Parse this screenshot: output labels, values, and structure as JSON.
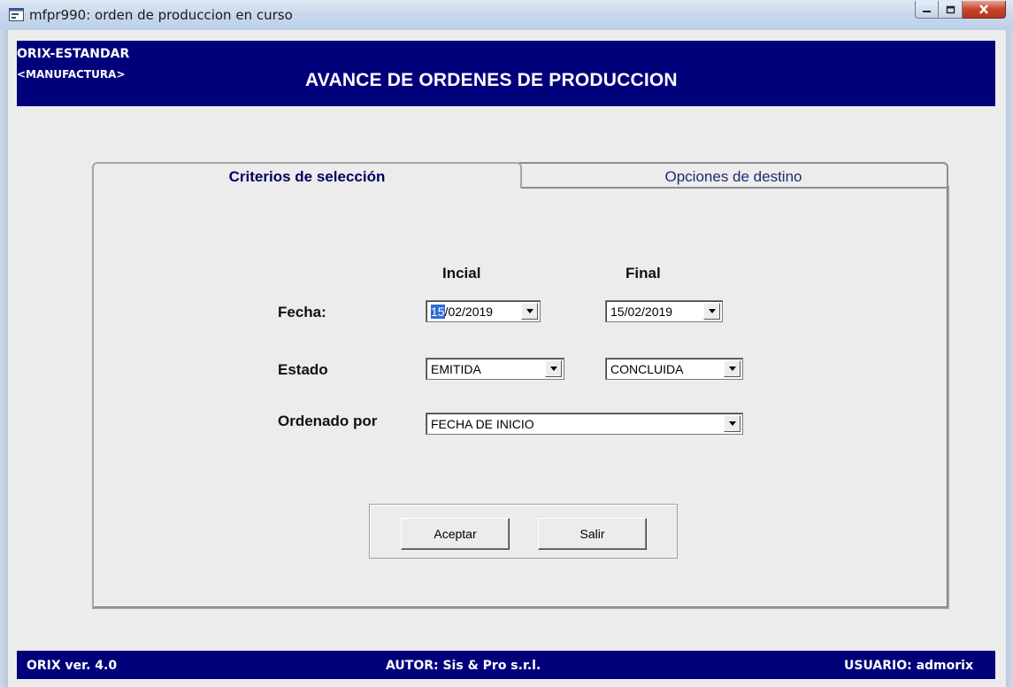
{
  "window": {
    "title": "mfpr990: orden de produccion en curso",
    "buttons": [
      "minimize",
      "maximize",
      "close"
    ]
  },
  "header": {
    "brand": "ORIX-ESTANDAR",
    "module": "<MANUFACTURA>",
    "title": "AVANCE DE ORDENES DE PRODUCCION"
  },
  "tabs": [
    {
      "label": "Criterios de selección",
      "active": true
    },
    {
      "label": "Opciones de destino",
      "active": false
    }
  ],
  "form": {
    "col_initial": "Incial",
    "col_final": "Final",
    "fecha_label": "Fecha:",
    "fecha_inicial_sel": "15",
    "fecha_inicial_rest": "/02/2019",
    "fecha_final": "15/02/2019",
    "estado_label": "Estado",
    "estado_inicial": "EMITIDA",
    "estado_final": "CONCLUIDA",
    "orden_label": "Ordenado por",
    "orden_value": "FECHA DE INICIO"
  },
  "actions": {
    "accept": "Aceptar",
    "exit": "Salir"
  },
  "status": {
    "version": "ORIX ver. 4.0",
    "author": "AUTOR: Sis & Pro s.r.l.",
    "user": "USUARIO: admorix"
  },
  "colors": {
    "band": "#00007b",
    "panel": "#ececec",
    "selection": "#2d6bd6"
  }
}
